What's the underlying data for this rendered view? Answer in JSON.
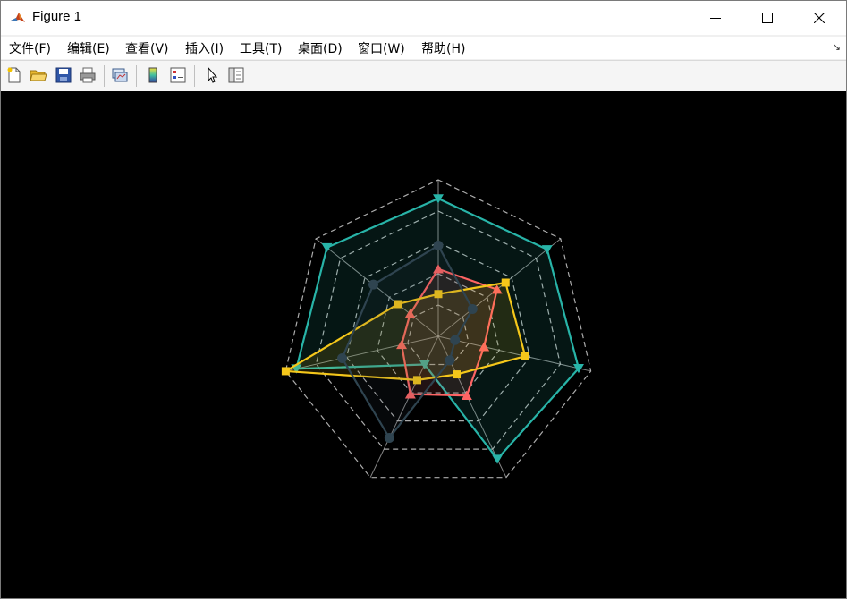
{
  "window": {
    "title": "Figure 1"
  },
  "menu": [
    "文件(F)",
    "编辑(E)",
    "查看(V)",
    "插入(I)",
    "工具(T)",
    "桌面(D)",
    "窗口(W)",
    "帮助(H)"
  ],
  "toolbar": [
    "new-figure",
    "open-file",
    "save",
    "print",
    "link-plot",
    "insert-colorbar",
    "insert-legend",
    "select-arrow",
    "property-inspector"
  ],
  "colors": {
    "background": "#000000",
    "grid": "#bfbfbf",
    "series": [
      "#28b4a8",
      "#ff6464",
      "#f5c71a",
      "#2f4450"
    ]
  },
  "chart_data": {
    "type": "radar",
    "axes": 7,
    "rlim": [
      0,
      1
    ],
    "rings": [
      0.2,
      0.4,
      0.6,
      0.8,
      1.0
    ],
    "grid": true,
    "series": [
      {
        "marker": "triangle-down",
        "values": [
          0.88,
          0.89,
          0.92,
          0.87,
          0.2,
          0.93,
          0.91
        ]
      },
      {
        "marker": "triangle-up",
        "values": [
          0.43,
          0.48,
          0.3,
          0.42,
          0.41,
          0.24,
          0.23
        ]
      },
      {
        "marker": "square",
        "values": [
          0.27,
          0.55,
          0.57,
          0.27,
          0.31,
          1.0,
          0.33
        ]
      },
      {
        "marker": "circle",
        "values": [
          0.58,
          0.28,
          0.11,
          0.17,
          0.72,
          0.63,
          0.53
        ]
      }
    ]
  }
}
